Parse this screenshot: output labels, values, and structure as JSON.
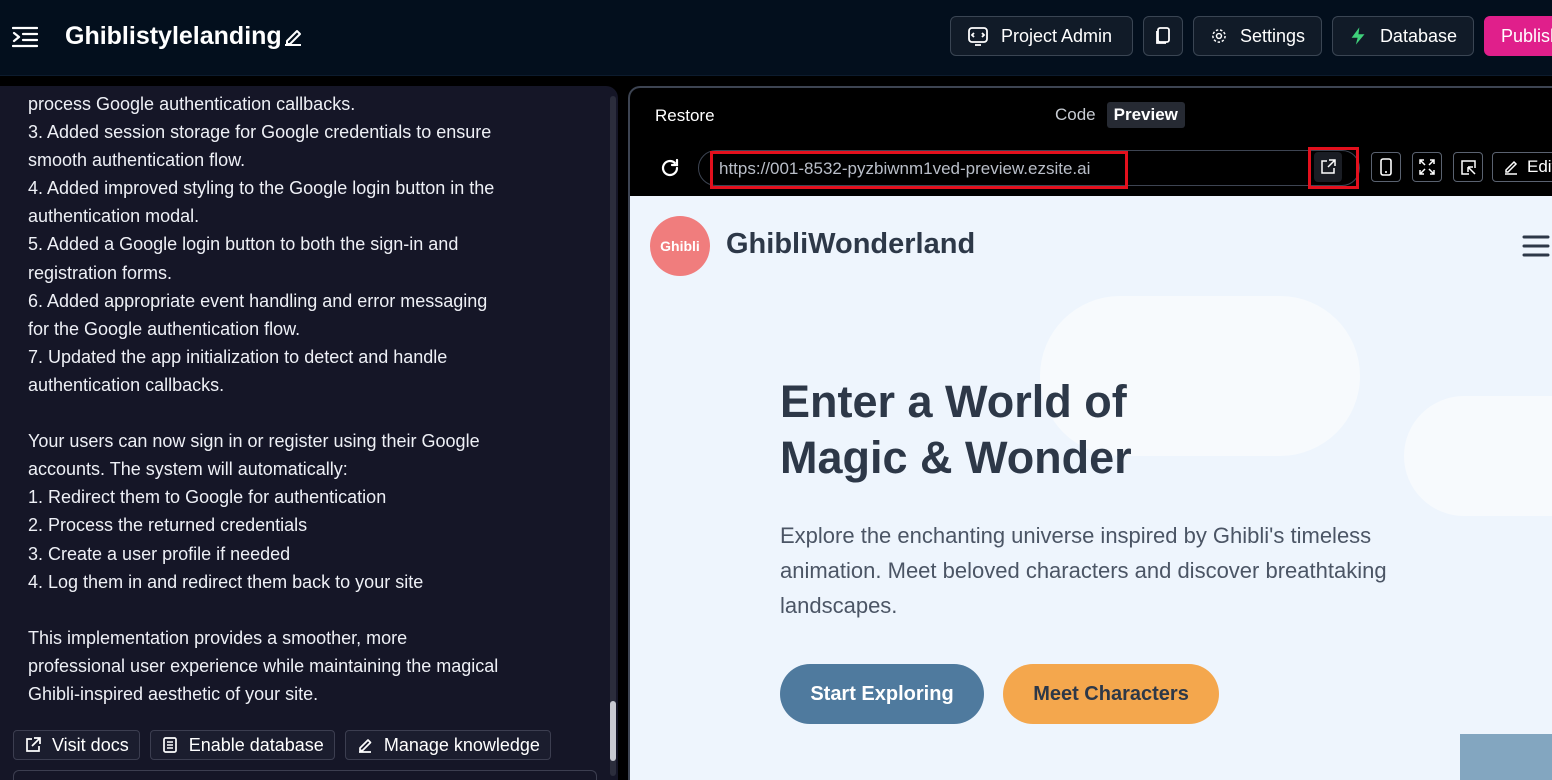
{
  "header": {
    "project_title": "Ghiblistylelanding",
    "buttons": {
      "project_admin": "Project Admin",
      "settings": "Settings",
      "database": "Database",
      "publish": "Publish"
    }
  },
  "chat": {
    "message": "process Google authentication callbacks.\n3. Added session storage for Google credentials to ensure smooth authentication flow.\n4. Added improved styling to the Google login button in the authentication modal.\n5. Added a Google login button to both the sign-in and registration forms.\n6. Added appropriate event handling and error messaging for the Google authentication flow.\n7. Updated the app initialization to detect and handle authentication callbacks.\n\nYour users can now sign in or register using their Google accounts. The system will automatically:\n1. Redirect them to Google for authentication\n2. Process the returned credentials\n3. Create a user profile if needed\n4. Log them in and redirect them back to your site\n\nThis implementation provides a smoother, more professional user experience while maintaining the magical Ghibli-inspired aesthetic of your site.",
    "actions": {
      "visit_docs": "Visit docs",
      "enable_database": "Enable database",
      "manage_knowledge": "Manage knowledge"
    }
  },
  "preview": {
    "restore": "Restore",
    "tabs": {
      "code": "Code",
      "preview": "Preview",
      "active": "Preview"
    },
    "url": "https://001-8532-pyzbiwnm1ved-preview.ezsite.ai",
    "edit_label": "Edit",
    "highlight_color": "#e3101d",
    "site": {
      "logo_text": "Ghibli",
      "brand": "GhibliWonderland",
      "hero_title_line1": "Enter a World of",
      "hero_title_line2": "Magic & Wonder",
      "hero_text": "Explore the enchanting universe inspired by Ghibli's timeless animation. Meet beloved characters and discover breathtaking landscapes.",
      "cta_primary": "Start Exploring",
      "cta_secondary": "Meet Characters",
      "colors": {
        "logo": "#f07d7d",
        "primary_button": "#4f7a9e",
        "secondary_button": "#f4a74d",
        "background": "#eef5fd"
      }
    }
  },
  "colors": {
    "publish_accent": "#e01f8b",
    "database_icon": "#3fd07a"
  }
}
